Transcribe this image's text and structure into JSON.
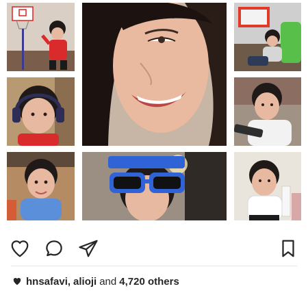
{
  "post": {
    "collage": {
      "tiles": [
        {
          "name": "photo-toddler-basketball",
          "bg": "#d9cfc4",
          "accent": "#d92b2b"
        },
        {
          "name": "photo-woman-selfie",
          "bg": "#3a2a22",
          "accent": "#e9b9a0"
        },
        {
          "name": "photo-toddler-couch",
          "bg": "#cfcfcf",
          "accent": "#58c04a"
        },
        {
          "name": "photo-toddler-headphones",
          "bg": "#b79a72",
          "accent": "#2d2d55"
        },
        {
          "name": "photo-toddler-tablet",
          "bg": "#a09386",
          "accent": "#f2f2f2"
        },
        {
          "name": "photo-toddler-blue-shirt",
          "bg": "#b48b62",
          "accent": "#5c8fd9"
        },
        {
          "name": "photo-child-birthday-glasses",
          "bg": "#9a8f82",
          "accent": "#2f63d6"
        },
        {
          "name": "photo-toddler-white-shirt",
          "bg": "#e9e4dc",
          "accent": "#ffffff"
        }
      ]
    },
    "actions": [
      {
        "name": "like-heart-icon",
        "interactable": true
      },
      {
        "name": "comment-icon",
        "interactable": true
      },
      {
        "name": "share-icon",
        "interactable": true
      },
      {
        "name": "bookmark-icon",
        "interactable": true
      }
    ],
    "likes": {
      "user1": "hnsafavi,",
      "user2": "alioji",
      "connector": "and",
      "count": "4,720 others"
    },
    "colors": {
      "text": "#262626",
      "divider": "#e6e6e6",
      "icon": "#262626"
    }
  }
}
